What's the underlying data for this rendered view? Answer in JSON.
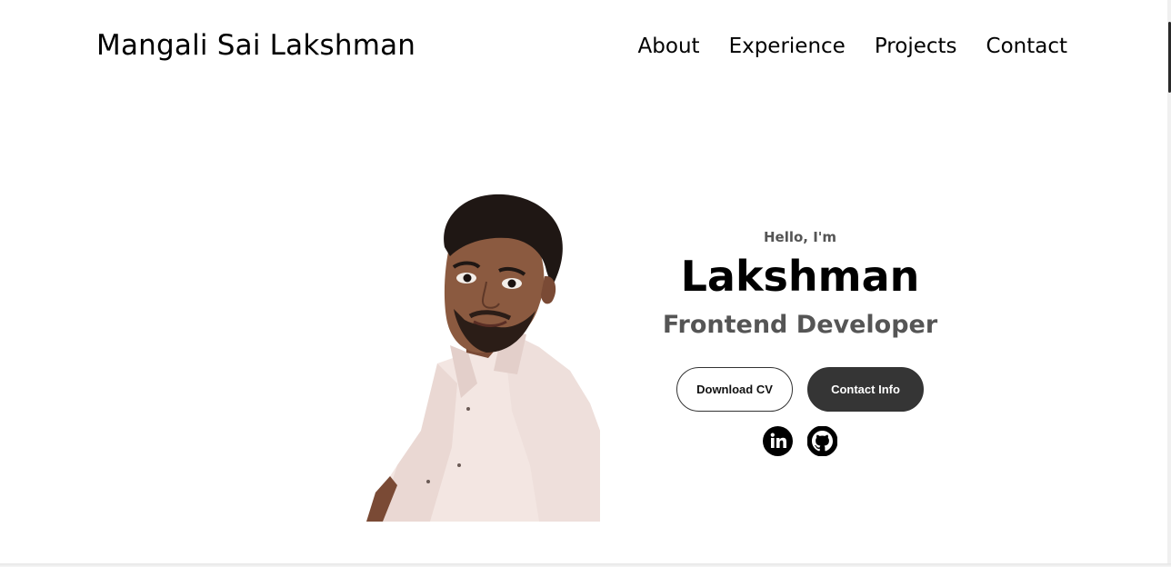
{
  "header": {
    "logo": "Mangali Sai Lakshman",
    "nav": [
      "About",
      "Experience",
      "Projects",
      "Contact"
    ]
  },
  "hero": {
    "greeting": "Hello, I'm",
    "name": "Lakshman",
    "role": "Frontend Developer",
    "buttons": {
      "download_cv": "Download CV",
      "contact_info": "Contact Info"
    },
    "socials": [
      {
        "icon": "linkedin-icon"
      },
      {
        "icon": "github-icon"
      }
    ]
  },
  "colors": {
    "text": "#000000",
    "muted": "#555555",
    "button_dark": "#353535"
  }
}
